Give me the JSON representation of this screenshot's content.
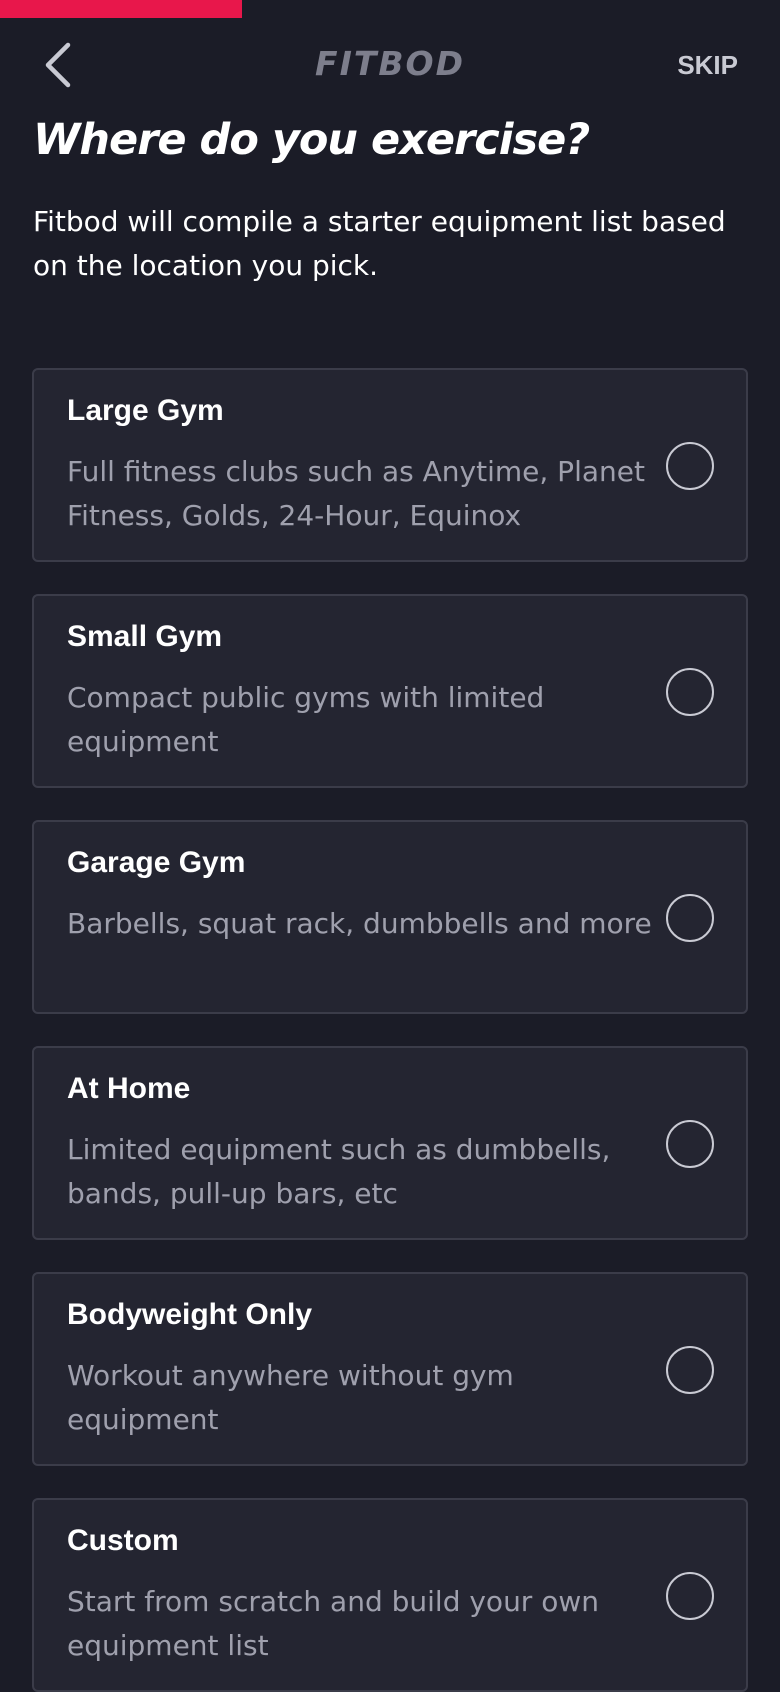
{
  "progress": {
    "fraction": 0.31,
    "color": "#e8174b"
  },
  "header": {
    "back_icon": "chevron-left-icon",
    "logo_text": "FITBOD",
    "skip_label": "SKIP"
  },
  "page": {
    "title": "Where do you exercise?",
    "subtitle": "Fitbod will compile a starter equipment list based on the location you pick."
  },
  "options": [
    {
      "title": "Large Gym",
      "description": "Full fitness clubs such as Anytime, Planet Fitness, Golds, 24-Hour, Equinox",
      "selected": false
    },
    {
      "title": "Small Gym",
      "description": "Compact public gyms with limited equipment",
      "selected": false
    },
    {
      "title": "Garage Gym",
      "description": "Barbells, squat rack, dumbbells and more",
      "selected": false
    },
    {
      "title": "At Home",
      "description": "Limited equipment such as dumbbells, bands, pull-up bars, etc",
      "selected": false
    },
    {
      "title": "Bodyweight Only",
      "description": "Workout anywhere without gym equipment",
      "selected": false
    },
    {
      "title": "Custom",
      "description": "Start from scratch and build your own equipment list",
      "selected": false
    }
  ]
}
